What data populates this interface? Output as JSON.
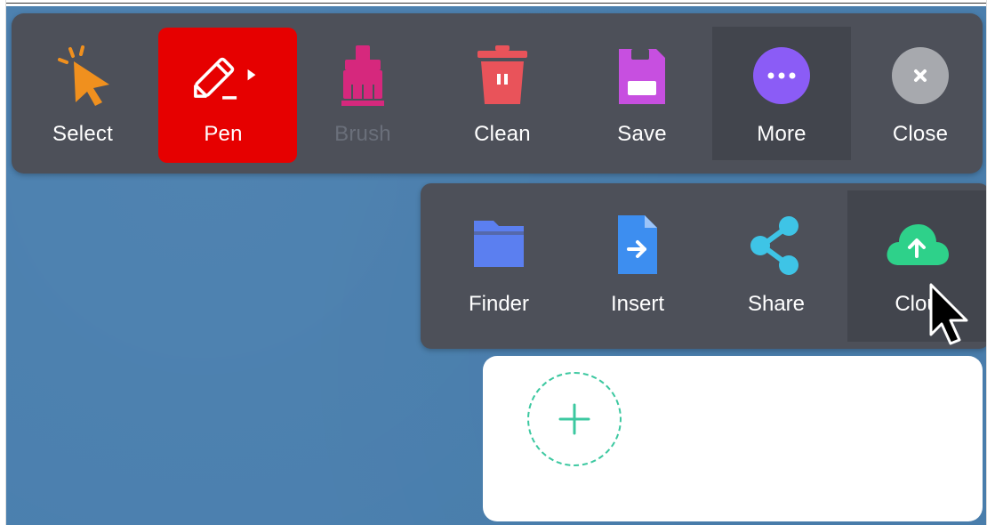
{
  "toolbar": {
    "items": [
      {
        "label": "Select",
        "icon": "cursor-pointer-icon",
        "color": "#f0901e",
        "state": "normal"
      },
      {
        "label": "Pen",
        "icon": "pen-icon",
        "color": "#ffffff",
        "state": "active"
      },
      {
        "label": "Brush",
        "icon": "brush-icon",
        "color": "#d6287d",
        "state": "disabled"
      },
      {
        "label": "Clean",
        "icon": "trash-icon",
        "color": "#e9535a",
        "state": "normal"
      },
      {
        "label": "Save",
        "icon": "save-icon",
        "color": "#c74fe0",
        "state": "normal"
      },
      {
        "label": "More",
        "icon": "more-icon",
        "color": "#8b5cf6",
        "state": "hover"
      },
      {
        "label": "Close",
        "icon": "close-icon",
        "color": "#a7a9ae",
        "state": "normal"
      }
    ]
  },
  "submenu": {
    "items": [
      {
        "label": "Finder",
        "icon": "folder-icon",
        "color": "#5b7ff0"
      },
      {
        "label": "Insert",
        "icon": "insert-file-icon",
        "color": "#3d8ef0"
      },
      {
        "label": "Share",
        "icon": "share-icon",
        "color": "#3ec4e6"
      },
      {
        "label": "Clou",
        "icon": "cloud-upload-icon",
        "color": "#2ed18a"
      }
    ]
  },
  "add_panel": {
    "icon": "plus-icon",
    "accent": "#3cc8a0"
  },
  "colors": {
    "board": "#4a7fae",
    "toolbar_bg": "#4d5059",
    "active": "#e60000"
  }
}
